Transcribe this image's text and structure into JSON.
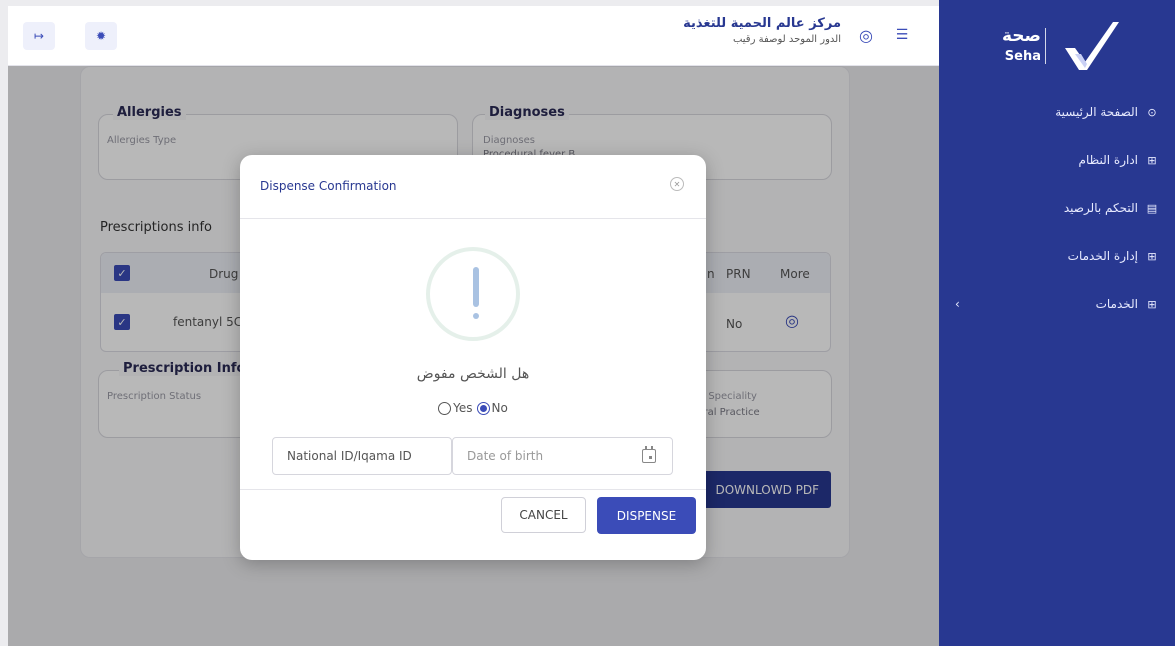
{
  "brand": {
    "ar": "صحة",
    "en": "Seha"
  },
  "sidebar": {
    "items": [
      {
        "label": "الصفحة الرئيسية",
        "icon": "⊙"
      },
      {
        "label": "ادارة النظام",
        "icon": "⊞"
      },
      {
        "label": "التحكم بالرصيد",
        "icon": "▤"
      },
      {
        "label": "إدارة الخدمات",
        "icon": "⊞"
      },
      {
        "label": "الخدمات",
        "icon": "⊞",
        "chevron": "‹"
      }
    ]
  },
  "header": {
    "title": "مركز عالم الحمية للتغذية",
    "subtitle": "الدور الموحد لوصفة رقيب",
    "logout_icon": "↦",
    "settings_icon": "✹",
    "profile_icon": "◎",
    "menu_icon": "☰"
  },
  "page": {
    "allergies": {
      "legend": "Allergies",
      "label": "Allergies Type"
    },
    "diagnoses": {
      "legend": "Diagnoses",
      "label": "Diagnoses",
      "value": "Procedural fever B..."
    },
    "prescriptions_title": "Prescriptions info",
    "table": {
      "headers": {
        "drug": "Drug",
        "prn": "PRN",
        "more": "More",
        "partial": "n"
      },
      "row": {
        "drug": "fentanyl 5C",
        "prn": "No"
      }
    },
    "prescription_info": {
      "legend": "Prescription Info",
      "status_label": "Prescription Status",
      "speciality_label": "tor Speciality",
      "speciality_value": "neral Practice"
    },
    "pdf_button": "DOWNLOWD PDF"
  },
  "modal": {
    "title": "Dispense Confirmation",
    "question": "هل الشخص مفوض",
    "yes_label": "Yes",
    "no_label": "No",
    "national_id_placeholder": "National ID/Iqama ID",
    "dob_placeholder": "Date of birth",
    "cancel_label": "CANCEL",
    "dispense_label": "DISPENSE"
  },
  "colors": {
    "primary": "#283891",
    "accent": "#3b4cb8"
  }
}
